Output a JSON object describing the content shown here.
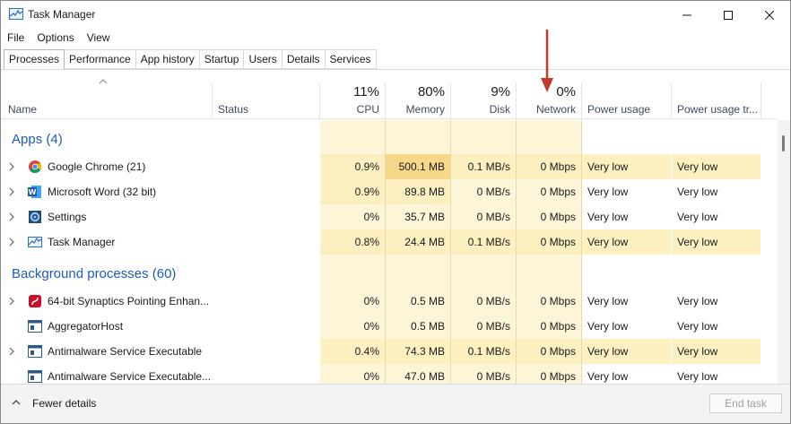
{
  "window": {
    "title": "Task Manager",
    "minimize": "—",
    "maximize": "☐",
    "close": "✕"
  },
  "menu": [
    "File",
    "Options",
    "View"
  ],
  "tabs": [
    "Processes",
    "Performance",
    "App history",
    "Startup",
    "Users",
    "Details",
    "Services"
  ],
  "active_tab": "Processes",
  "columns": {
    "name": "Name",
    "status": "Status",
    "cpu": {
      "pct": "11%",
      "label": "CPU"
    },
    "memory": {
      "pct": "80%",
      "label": "Memory"
    },
    "disk": {
      "pct": "9%",
      "label": "Disk"
    },
    "network": {
      "pct": "0%",
      "label": "Network"
    },
    "power": "Power usage",
    "power_trend": "Power usage tr..."
  },
  "groups": {
    "apps": {
      "title": "Apps (4)",
      "rows": [
        {
          "name": "Google Chrome (21)",
          "icon": "chrome-icon",
          "cpu": "0.9%",
          "memory": "500.1 MB",
          "disk": "0.1 MB/s",
          "network": "0 Mbps",
          "power": "Very low",
          "power_trend": "Very low"
        },
        {
          "name": "Microsoft Word (32 bit)",
          "icon": "word-icon",
          "cpu": "0.9%",
          "memory": "89.8 MB",
          "disk": "0 MB/s",
          "network": "0 Mbps",
          "power": "Very low",
          "power_trend": "Very low"
        },
        {
          "name": "Settings",
          "icon": "settings-icon",
          "cpu": "0%",
          "memory": "35.7 MB",
          "disk": "0 MB/s",
          "network": "0 Mbps",
          "power": "Very low",
          "power_trend": "Very low"
        },
        {
          "name": "Task Manager",
          "icon": "task-manager-icon",
          "cpu": "0.8%",
          "memory": "24.4 MB",
          "disk": "0.1 MB/s",
          "network": "0 Mbps",
          "power": "Very low",
          "power_trend": "Very low"
        }
      ]
    },
    "background": {
      "title": "Background processes (60)",
      "rows": [
        {
          "name": "64-bit Synaptics Pointing Enhan...",
          "icon": "synaptics-icon",
          "cpu": "0%",
          "memory": "0.5 MB",
          "disk": "0 MB/s",
          "network": "0 Mbps",
          "power": "Very low",
          "power_trend": "Very low"
        },
        {
          "name": "AggregatorHost",
          "icon": "process-icon",
          "cpu": "0%",
          "memory": "0.5 MB",
          "disk": "0 MB/s",
          "network": "0 Mbps",
          "power": "Very low",
          "power_trend": "Very low"
        },
        {
          "name": "Antimalware Service Executable",
          "icon": "process-icon",
          "cpu": "0.4%",
          "memory": "74.3 MB",
          "disk": "0.1 MB/s",
          "network": "0 Mbps",
          "power": "Very low",
          "power_trend": "Very low"
        },
        {
          "name": "Antimalware Service Executable...",
          "icon": "process-icon",
          "cpu": "0%",
          "memory": "47.0 MB",
          "disk": "0 MB/s",
          "network": "0 Mbps",
          "power": "Very low",
          "power_trend": "Very low"
        }
      ]
    }
  },
  "footer": {
    "fewer_details": "Fewer details",
    "end_task": "End task"
  },
  "colors": {
    "accent": "#1e5bb8",
    "heat_light": "#fdf5d8",
    "heat_mid": "#fcefc0",
    "heat_high": "#f9d78a",
    "annotation": "#c0392b"
  }
}
